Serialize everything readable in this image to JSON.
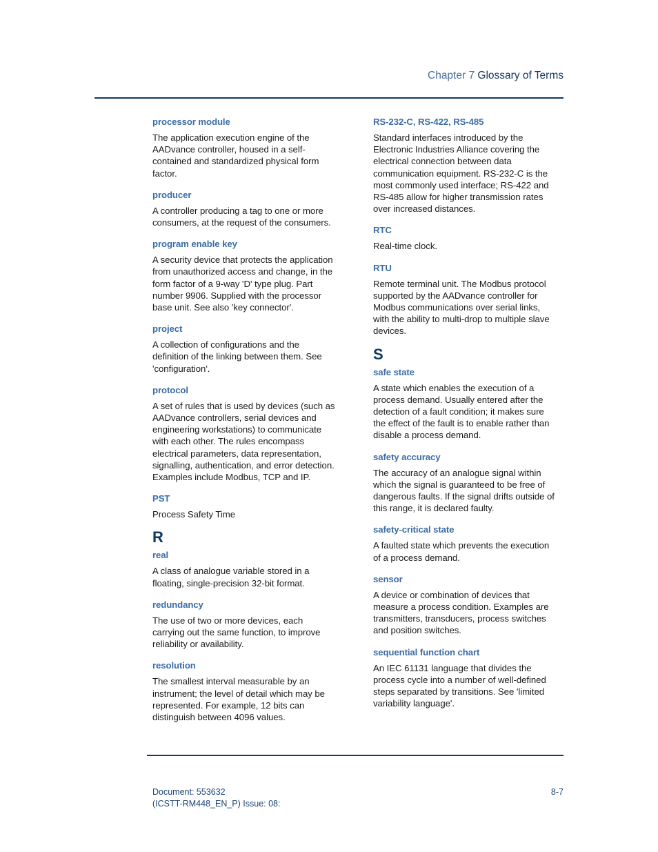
{
  "header": {
    "chapter_label": "Chapter 7",
    "chapter_title": "Glossary of Terms"
  },
  "columns": {
    "left": [
      {
        "kind": "entry",
        "term": "processor module",
        "definition": "The application execution engine of the AADvance controller, housed in a self-contained and standardized physical form factor."
      },
      {
        "kind": "entry",
        "term": "producer",
        "definition": "A controller producing a tag to one or more consumers, at the request of the consumers."
      },
      {
        "kind": "entry",
        "term": "program enable key",
        "definition": "A security device that protects the application from unauthorized access and change, in the form factor of a 9-way 'D' type plug. Part number 9906. Supplied with the processor base unit. See also 'key connector'."
      },
      {
        "kind": "entry",
        "term": "project",
        "definition": "A collection of configurations and the definition of the linking between them. See 'configuration'."
      },
      {
        "kind": "entry",
        "term": "protocol",
        "definition": "A set of rules that is used by devices (such as AADvance controllers, serial devices and engineering workstations) to communicate with each other. The rules encompass electrical parameters, data representation, signalling, authentication, and error detection. Examples include Modbus, TCP and IP."
      },
      {
        "kind": "entry",
        "term": "PST",
        "definition": "Process Safety Time"
      },
      {
        "kind": "letter",
        "letter": "R"
      },
      {
        "kind": "entry",
        "term": "real",
        "definition": "A class of analogue variable stored in a floating, single-precision 32-bit format."
      },
      {
        "kind": "entry",
        "term": "redundancy",
        "definition": "The use of two or more devices, each carrying out the same function, to improve reliability or availability."
      },
      {
        "kind": "entry",
        "term": "resolution",
        "definition": "The smallest interval measurable by an instrument; the level of detail which may be represented. For example, 12 bits can distinguish between 4096 values."
      }
    ],
    "right": [
      {
        "kind": "entry",
        "term": "RS-232-C, RS-422, RS-485",
        "definition": "Standard interfaces introduced by the Electronic Industries Alliance covering the electrical connection between data communication equipment. RS-232-C is the most commonly used interface; RS-422 and RS-485 allow for higher transmission rates over increased distances."
      },
      {
        "kind": "entry",
        "term": "RTC",
        "definition": "Real-time clock."
      },
      {
        "kind": "entry",
        "term": "RTU",
        "definition": "Remote terminal unit. The Modbus protocol supported by the AADvance controller for Modbus communications over serial links, with the ability to multi-drop to multiple slave devices."
      },
      {
        "kind": "letter",
        "letter": "S"
      },
      {
        "kind": "entry",
        "term": "safe state",
        "definition": "A state which enables the execution of a process demand. Usually entered after the detection of a fault condition; it makes sure the effect of the fault is to enable rather than disable a process demand."
      },
      {
        "kind": "entry",
        "term": "safety accuracy",
        "definition": "The accuracy of an analogue signal within which the signal is guaranteed to be free of dangerous faults. If the signal drifts outside of this range, it is declared faulty."
      },
      {
        "kind": "entry",
        "term": "safety-critical state",
        "definition": "A faulted state which prevents the execution of a process demand."
      },
      {
        "kind": "entry",
        "term": "sensor",
        "definition": "A device or combination of devices that measure a process condition. Examples are transmitters, transducers, process switches and position switches."
      },
      {
        "kind": "entry",
        "term": "sequential function chart",
        "definition": "An IEC 61131 language that divides the process cycle into a number of well-defined steps separated by transitions. See 'limited variability language'."
      }
    ]
  },
  "footer": {
    "document_line_1": "Document: 553632",
    "document_line_2": "(ICSTT-RM448_EN_P) Issue: 08:",
    "page_number": "8-7"
  },
  "colors": {
    "rule": "#103861",
    "term": "#3b6ca5",
    "section_letter": "#103861",
    "body": "#1b1b1b",
    "footer": "#1d4473",
    "chapter_label": "#4a6f9e",
    "chapter_title": "#15355c"
  }
}
